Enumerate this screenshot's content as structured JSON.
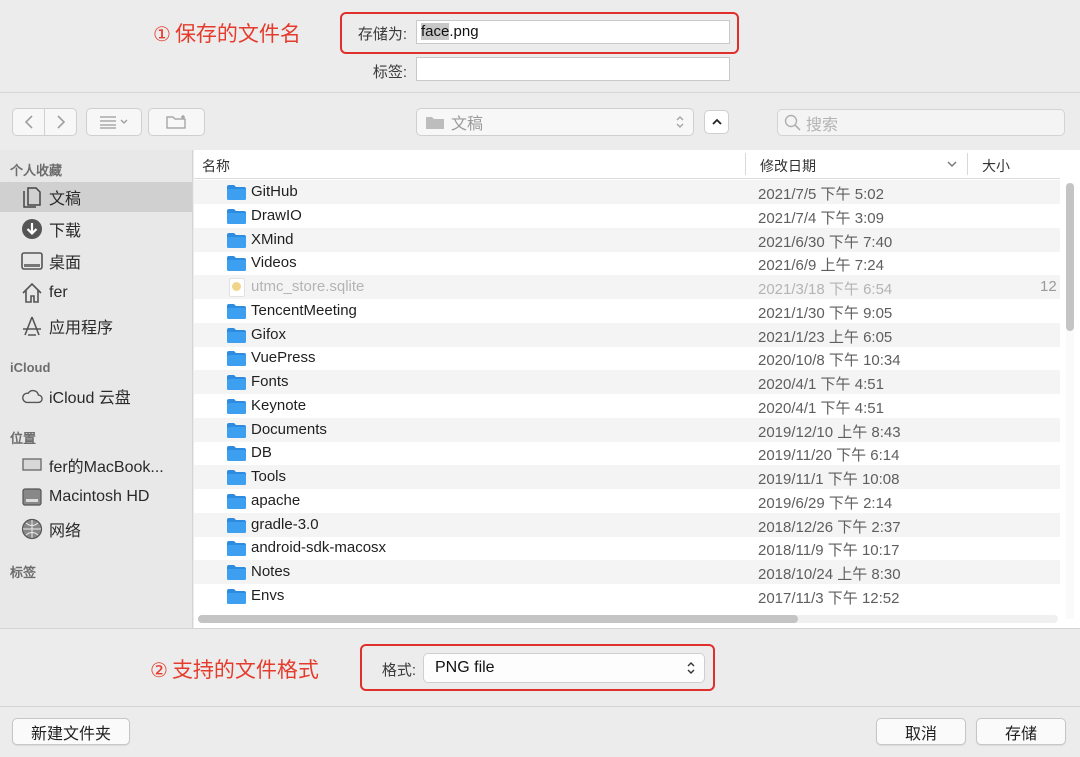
{
  "annotations": {
    "save_name": {
      "num": "①",
      "text": "保存的文件名"
    },
    "formats": {
      "num": "②",
      "text": "支持的文件格式"
    }
  },
  "save_as": {
    "label": "存储为:",
    "value_selected": "face",
    "value_rest": ".png"
  },
  "tags": {
    "label": "标签:",
    "value": ""
  },
  "toolbar": {
    "location": "文稿",
    "search_placeholder": "搜索"
  },
  "sidebar": {
    "favorites_header": "个人收藏",
    "favorites": [
      {
        "label": "文稿",
        "icon": "document-icon",
        "active": true
      },
      {
        "label": "下载",
        "icon": "download-icon",
        "active": false
      },
      {
        "label": "桌面",
        "icon": "desktop-icon",
        "active": false
      },
      {
        "label": "fer",
        "icon": "home-icon",
        "active": false
      },
      {
        "label": "应用程序",
        "icon": "applications-icon",
        "active": false
      }
    ],
    "icloud_header": "iCloud",
    "icloud": [
      {
        "label": "iCloud 云盘",
        "icon": "cloud-icon"
      }
    ],
    "locations_header": "位置",
    "locations": [
      {
        "label": "fer的MacBook...",
        "icon": "laptop-icon"
      },
      {
        "label": "Macintosh HD",
        "icon": "harddisk-icon"
      },
      {
        "label": "网络",
        "icon": "network-icon"
      }
    ],
    "tags_header": "标签"
  },
  "columns": {
    "name": "名称",
    "date": "修改日期",
    "size": "大小"
  },
  "files": [
    {
      "name": "GitHub",
      "date": "2021/7/5 下午 5:02",
      "size": "",
      "folder": true
    },
    {
      "name": "DrawIO",
      "date": "2021/7/4 下午 3:09",
      "size": "",
      "folder": true
    },
    {
      "name": "XMind",
      "date": "2021/6/30 下午 7:40",
      "size": "",
      "folder": true
    },
    {
      "name": "Videos",
      "date": "2021/6/9 上午 7:24",
      "size": "",
      "folder": true
    },
    {
      "name": "utmc_store.sqlite",
      "date": "2021/3/18 下午 6:54",
      "size": "12",
      "folder": false
    },
    {
      "name": "TencentMeeting",
      "date": "2021/1/30 下午 9:05",
      "size": "",
      "folder": true
    },
    {
      "name": "Gifox",
      "date": "2021/1/23 上午 6:05",
      "size": "",
      "folder": true
    },
    {
      "name": "VuePress",
      "date": "2020/10/8 下午 10:34",
      "size": "",
      "folder": true
    },
    {
      "name": "Fonts",
      "date": "2020/4/1 下午 4:51",
      "size": "",
      "folder": true
    },
    {
      "name": "Keynote",
      "date": "2020/4/1 下午 4:51",
      "size": "",
      "folder": true
    },
    {
      "name": "Documents",
      "date": "2019/12/10 上午 8:43",
      "size": "",
      "folder": true
    },
    {
      "name": "DB",
      "date": "2019/11/20 下午 6:14",
      "size": "",
      "folder": true
    },
    {
      "name": "Tools",
      "date": "2019/11/1 下午 10:08",
      "size": "",
      "folder": true
    },
    {
      "name": "apache",
      "date": "2019/6/29 下午 2:14",
      "size": "",
      "folder": true
    },
    {
      "name": "gradle-3.0",
      "date": "2018/12/26 下午 2:37",
      "size": "",
      "folder": true
    },
    {
      "name": "android-sdk-macosx",
      "date": "2018/11/9 下午 10:17",
      "size": "",
      "folder": true
    },
    {
      "name": "Notes",
      "date": "2018/10/24 上午 8:30",
      "size": "",
      "folder": true
    },
    {
      "name": "Envs",
      "date": "2017/11/3 下午 12:52",
      "size": "",
      "folder": true
    }
  ],
  "format": {
    "label": "格式:",
    "value": "PNG file"
  },
  "buttons": {
    "new_folder": "新建文件夹",
    "cancel": "取消",
    "save": "存储"
  },
  "colors": {
    "annotation": "#e53b2c",
    "folder": "#3d9ff0"
  }
}
